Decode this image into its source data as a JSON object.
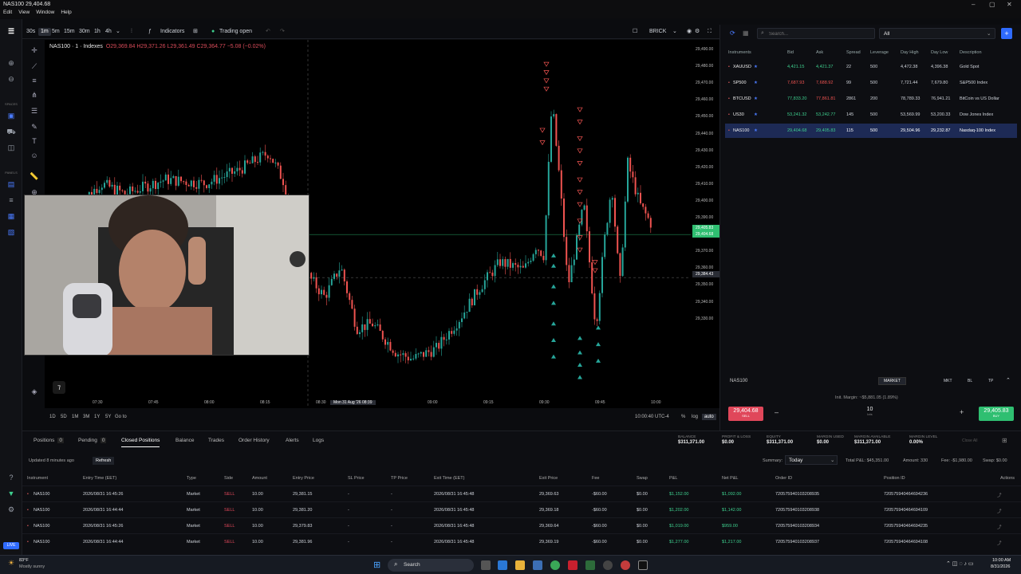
{
  "window": {
    "title": "NAS100 29,404.68"
  },
  "menu": [
    "Edit",
    "View",
    "Window",
    "Help"
  ],
  "leftbar": {
    "labels": [
      "SPACES",
      "PANELS"
    ],
    "live": "LIVE"
  },
  "toolbar": {
    "intervals": [
      "30s",
      "1m",
      "5m",
      "15m",
      "30m",
      "1h",
      "4h"
    ],
    "active_interval": "1m",
    "indicators": "Indicators",
    "trading": "Trading open",
    "brick": "BRICK"
  },
  "legend": {
    "symbol": "NAS100 · 1 · Indexes",
    "o": "O29,369.84",
    "h": "H29,371.26",
    "l": "L29,361.49",
    "c": "C29,364.77",
    "chg": "−5.08 (−0.02%)"
  },
  "yaxis": {
    "ticks": [
      "29,490.00",
      "29,480.00",
      "29,470.00",
      "29,460.00",
      "29,450.00",
      "29,440.00",
      "29,430.00",
      "29,420.00",
      "29,410.00",
      "29,400.00",
      "29,390.00",
      "29,380.00",
      "29,370.00",
      "29,360.00",
      "29,350.00",
      "29,340.00",
      "29,330.00"
    ],
    "price_ask": "29,405.83",
    "price_bid": "29,404.68",
    "crosshair": "29,384.43"
  },
  "xaxis": {
    "ticks": [
      "07:30",
      "07:45",
      "08:00",
      "08:15",
      "08:30",
      "Mon 31 Aug '26   08:39",
      "09:00",
      "09:15",
      "09:30",
      "09:45",
      "10:00"
    ]
  },
  "timebar": {
    "ranges": [
      "1D",
      "5D",
      "1M",
      "3M",
      "1Y",
      "5Y",
      "Go to"
    ],
    "clock": "10:00:40 UTC-4",
    "pct": "%",
    "log": "log",
    "auto": "auto"
  },
  "chart_data": {
    "type": "candlestick",
    "title": "NAS100 · 1 · Indexes",
    "xlabel": "",
    "ylabel": "",
    "ylim": [
      29325,
      29495
    ],
    "xlim": [
      "07:20",
      "10:05"
    ],
    "current_price": 29404.68,
    "crosshair_price": 29384.43
  },
  "watchlist": {
    "search_placeholder": "Search...",
    "filter": "All",
    "headers": [
      "Instruments",
      "Bid",
      "Ask",
      "Spread",
      "Leverage",
      "Day High",
      "Day Low",
      "Description"
    ],
    "rows": [
      {
        "sym": "XAUUSD",
        "bid": "4,421.15",
        "ask": "4,421.37",
        "spread": "22",
        "lev": "500",
        "high": "4,472.38",
        "low": "4,396.38",
        "desc": "Gold Spot",
        "dir": "up"
      },
      {
        "sym": "SP500",
        "bid": "7,687.93",
        "ask": "7,688.92",
        "spread": "99",
        "lev": "500",
        "high": "7,721.44",
        "low": "7,679.80",
        "desc": "S&P500 Index",
        "dir": "down"
      },
      {
        "sym": "BTCUSD",
        "bid": "77,833.20",
        "ask": "77,861.81",
        "spread": "2861",
        "lev": "200",
        "high": "78,789.33",
        "low": "76,941.21",
        "desc": "BitCoin vs US Dollar",
        "dir": "up-down"
      },
      {
        "sym": "US30",
        "bid": "53,241.32",
        "ask": "53,242.77",
        "spread": "145",
        "lev": "500",
        "high": "53,569.99",
        "low": "53,200.33",
        "desc": "Dow Jones Index",
        "dir": "up"
      },
      {
        "sym": "NAS100",
        "bid": "29,404.68",
        "ask": "29,405.83",
        "spread": "115",
        "lev": "500",
        "high": "29,504.96",
        "low": "29,232.87",
        "desc": "Nasdaq-100 Index",
        "dir": "up"
      }
    ]
  },
  "ticket": {
    "symbol": "NAS100",
    "type": "MARKET",
    "tabs": [
      "MKT",
      "BL",
      "TP"
    ],
    "margin": "Init. Margin: ~$5,881.05 (1.89%)",
    "sell": "29,404.68",
    "sell_sub": "SELL",
    "buy": "29,405.83",
    "buy_sub": "BUY",
    "lots": "10",
    "lots_label": "lots"
  },
  "bottom": {
    "tabs": [
      "Positions",
      "Pending",
      "Closed Positions",
      "Balance",
      "Trades",
      "Order History",
      "Alerts",
      "Logs"
    ],
    "tab_counts": {
      "Positions": "0",
      "Pending": "0"
    },
    "account": [
      {
        "label": "BALANCE",
        "value": "$311,371.00"
      },
      {
        "label": "PROFIT & LOSS",
        "value": "$0.00"
      },
      {
        "label": "EQUITY",
        "value": "$311,371.00"
      },
      {
        "label": "MARGIN USED",
        "value": "$0.00"
      },
      {
        "label": "MARGIN AVAILABLE",
        "value": "$311,371.00"
      },
      {
        "label": "MARGIN LEVEL",
        "value": "0.00%"
      }
    ],
    "close_all": "Close All",
    "updated": "Updated 8 minutes ago",
    "refresh": "Refresh",
    "summary_label": "Summary:",
    "summary_value": "Today",
    "total_pl": "Total P&L: $45,351.00",
    "amount": "Amount: 330",
    "fee": "Fee: -$1,980.00",
    "swap": "Swap: $0.00",
    "headers": [
      "Instrument",
      "Entry Time (EET)",
      "Type",
      "Side",
      "Amount",
      "Entry Price",
      "SL Price",
      "TP Price",
      "Exit Time (EET)",
      "Exit Price",
      "Fee",
      "Swap",
      "P&L",
      "Net P&L",
      "Order ID",
      "Position ID",
      "Actions"
    ],
    "rows": [
      {
        "inst": "NAS100",
        "entry_time": "2026/08/31 16:45:26",
        "type": "Market",
        "side": "SELL",
        "amount": "10.00",
        "entry": "29,381.15",
        "sl": "-",
        "tp": "-",
        "exit_time": "2026/08/31 16:45:48",
        "exit": "29,369.63",
        "fee": "-$60.00",
        "swap": "$0.00",
        "pl": "$1,152.00",
        "net": "$1,092.00",
        "order": "720575940103208935",
        "pos": "720575940464694236"
      },
      {
        "inst": "NAS100",
        "entry_time": "2026/08/31 16:44:44",
        "type": "Market",
        "side": "SELL",
        "amount": "10.00",
        "entry": "29,381.20",
        "sl": "-",
        "tp": "-",
        "exit_time": "2026/08/31 16:45:48",
        "exit": "29,369.18",
        "fee": "-$60.00",
        "swap": "$0.00",
        "pl": "$1,202.00",
        "net": "$1,142.00",
        "order": "720575940103208938",
        "pos": "720575940464694109"
      },
      {
        "inst": "NAS100",
        "entry_time": "2026/08/31 16:45:26",
        "type": "Market",
        "side": "SELL",
        "amount": "10.00",
        "entry": "29,379.83",
        "sl": "-",
        "tp": "-",
        "exit_time": "2026/08/31 16:45:48",
        "exit": "29,369.64",
        "fee": "-$60.00",
        "swap": "$0.00",
        "pl": "$1,019.00",
        "net": "$959.00",
        "order": "720575940103208934",
        "pos": "720575940464694235"
      },
      {
        "inst": "NAS100",
        "entry_time": "2026/08/31 16:44:44",
        "type": "Market",
        "side": "SELL",
        "amount": "10.00",
        "entry": "29,381.96",
        "sl": "-",
        "tp": "-",
        "exit_time": "2026/08/31 16:45:48",
        "exit": "29,369.19",
        "fee": "-$60.00",
        "swap": "$0.00",
        "pl": "$1,277.00",
        "net": "$1,217.00",
        "order": "720575940103208937",
        "pos": "720575940464694108"
      }
    ]
  },
  "taskbar": {
    "weather_temp": "83°F",
    "weather_desc": "Mostly sunny",
    "search": "Search",
    "time": "10:00 AM",
    "date": "8/31/2026"
  },
  "colors": {
    "up": "#26a69a",
    "down": "#ef5350",
    "accent": "#2f6bff",
    "sell": "#e0475a",
    "buy": "#2fbf71"
  }
}
